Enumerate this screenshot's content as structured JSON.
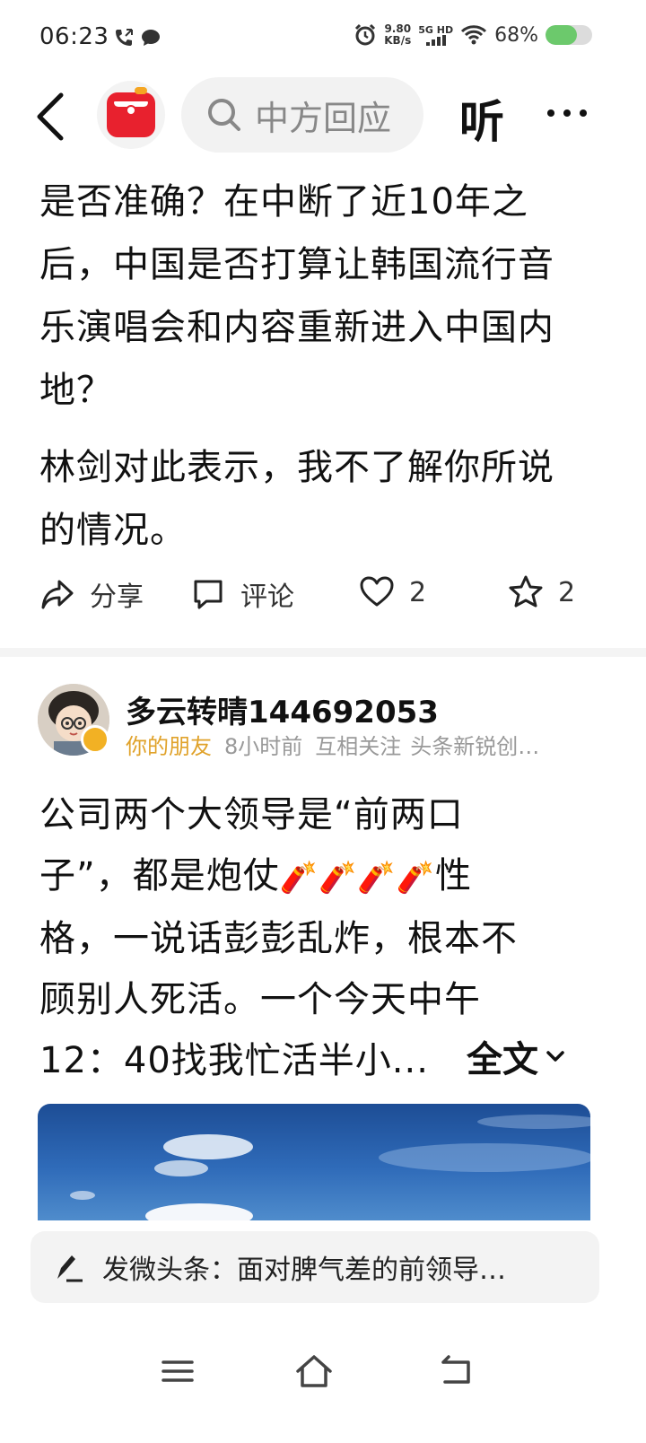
{
  "status_bar": {
    "time": "06:23",
    "net_speed_value": "9.80",
    "net_speed_unit": "KB/s",
    "network": "5G HD",
    "battery_percent": "68%",
    "battery_level": 0.68,
    "battery_color": "#6cc96c"
  },
  "top_nav": {
    "search_text": "中方回应",
    "listen_label": "听"
  },
  "article": {
    "paragraph1": "是否准确？在中断了近10年之后，中国是否打算让韩国流行音乐演唱会和内容重新进入中国内地？",
    "paragraph2": "林剑对此表示，我不了解你所说的情况。",
    "actions": {
      "share_label": "分享",
      "comment_label": "评论",
      "like_count": "2",
      "favorite_count": "2"
    }
  },
  "post": {
    "author": "多云转晴144692053",
    "friend_tag": "你的朋友",
    "time": "8小时前",
    "follow_status": "互相关注",
    "badge_text": "头条新锐创…",
    "text_line1": "公司两个大领导是“前两口",
    "text_line2a": "子”，都是炮仗",
    "text_line2b": "性",
    "text_line3": "格，一说话彭彭乱炸，根本不",
    "text_line4": "顾别人死活。一个今天中午",
    "text_line5": "12：40找我忙活半小...",
    "fullread_label": "全文",
    "emoji_firecrackers": "🧨🧨🧨🧨"
  },
  "compose": {
    "text": "发微头条：面对脾气差的前领导…"
  },
  "icons": {
    "back": "back-arrow-icon",
    "search": "search-icon",
    "share": "share-icon",
    "comment": "comment-icon",
    "like": "heart-icon",
    "favorite": "star-icon",
    "compose": "pen-icon",
    "menu": "menu-icon",
    "home": "home-icon",
    "back_nav": "return-icon"
  }
}
